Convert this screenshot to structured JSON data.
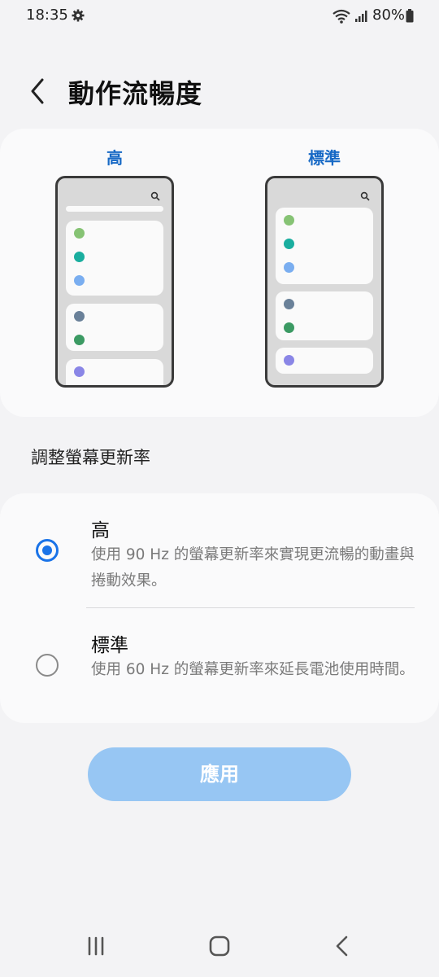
{
  "status_bar": {
    "time": "18:35",
    "battery": "80%",
    "icons": [
      "gear-icon",
      "wifi-icon",
      "signal-icon",
      "battery-icon"
    ]
  },
  "header": {
    "title": "動作流暢度",
    "back_icon": "chevron-left-icon"
  },
  "preview": {
    "high_label": "高",
    "standard_label": "標準",
    "dot_colors_high": [
      "#86c374",
      "#1aae9f",
      "#7aaef0",
      "#6a8199",
      "#3b9a63",
      "#8a86e6"
    ],
    "dot_colors_standard": [
      "#86c374",
      "#1aae9f",
      "#7aaef0",
      "#6a8199",
      "#3b9a63",
      "#8a86e6"
    ]
  },
  "section_label": "調整螢幕更新率",
  "options": [
    {
      "title": "高",
      "description": "使用 90 Hz 的螢幕更新率來實現更流暢的動畫與捲動效果。",
      "selected": true
    },
    {
      "title": "標準",
      "description": "使用 60 Hz 的螢幕更新率來延長電池使用時間。",
      "selected": false
    }
  ],
  "apply_button": "應用",
  "nav": [
    "recent-apps-icon",
    "home-icon",
    "back-icon"
  ],
  "colors": {
    "accent": "#1a73e8",
    "label_blue": "#1769c5",
    "apply_bg": "#97c6f3",
    "background": "#f3f3f5"
  }
}
